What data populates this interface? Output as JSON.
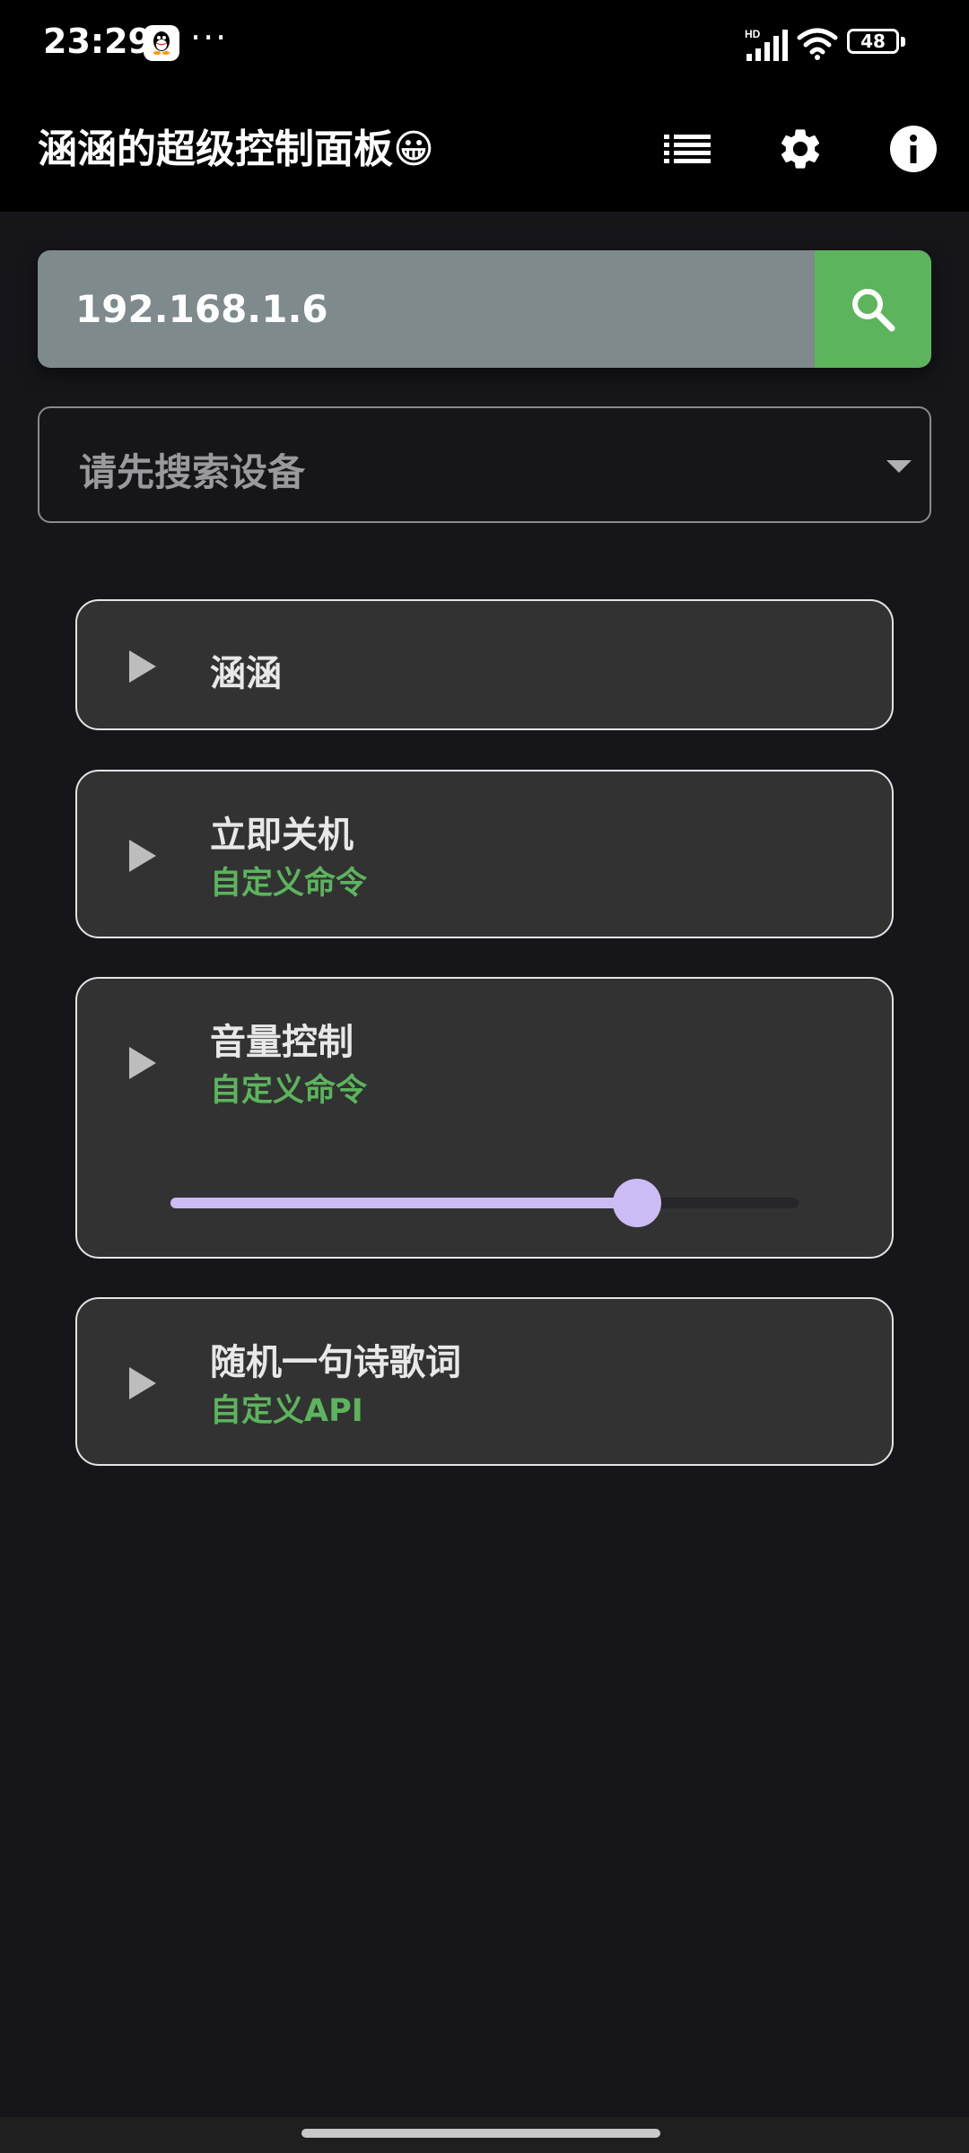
{
  "status_bar": {
    "time": "23:29",
    "notification_icons": [
      "qq-icon",
      "more-dots-icon"
    ],
    "more_dots": "···",
    "hd_label": "HD",
    "battery": "48"
  },
  "app_bar": {
    "title": "涵涵的超级控制面板😀",
    "actions": [
      "list-icon",
      "gear-icon",
      "info-icon"
    ]
  },
  "search": {
    "value": "192.168.1.6",
    "button_icon": "search-icon"
  },
  "device_select": {
    "placeholder": "请先搜索设备"
  },
  "commands": [
    {
      "title": "涵涵",
      "subtitle": ""
    },
    {
      "title": "立即关机",
      "subtitle": "自定义命令"
    },
    {
      "title": "音量控制",
      "subtitle": "自定义命令",
      "volume": 0.75
    },
    {
      "title": "随机一句诗歌词",
      "subtitle": "自定义API"
    }
  ],
  "colors": {
    "accent_green": "#5cb45d",
    "slider": "#cbbcf6",
    "background": "#16151a",
    "card": "#323232"
  }
}
